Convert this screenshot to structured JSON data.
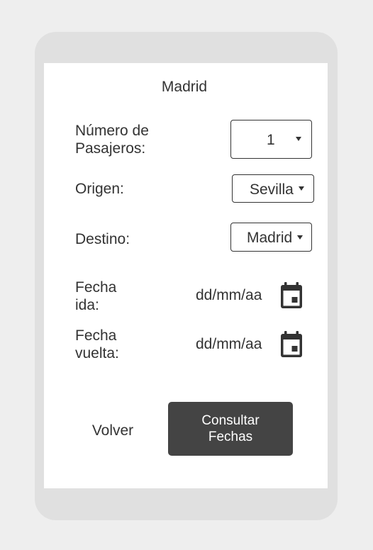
{
  "header": {
    "title": "Madrid"
  },
  "form": {
    "passengers": {
      "label": "Número de Pasajeros:",
      "value": "1"
    },
    "origin": {
      "label": "Origen:",
      "value": "Sevilla"
    },
    "destination": {
      "label": "Destino:",
      "value": "Madrid"
    },
    "departure_date": {
      "label": "Fecha ida:",
      "value": "dd/mm/aa",
      "icon": "calendar-icon"
    },
    "return_date": {
      "label": "Fecha vuelta:",
      "value": "dd/mm/aa",
      "icon": "calendar-icon"
    }
  },
  "actions": {
    "back_label": "Volver",
    "submit_label": "Consultar Fechas"
  },
  "colors": {
    "device_frame": "#e0e0e0",
    "screen": "#ffffff",
    "text": "#333333",
    "primary_button": "#444444",
    "primary_button_text": "#ffffff"
  }
}
